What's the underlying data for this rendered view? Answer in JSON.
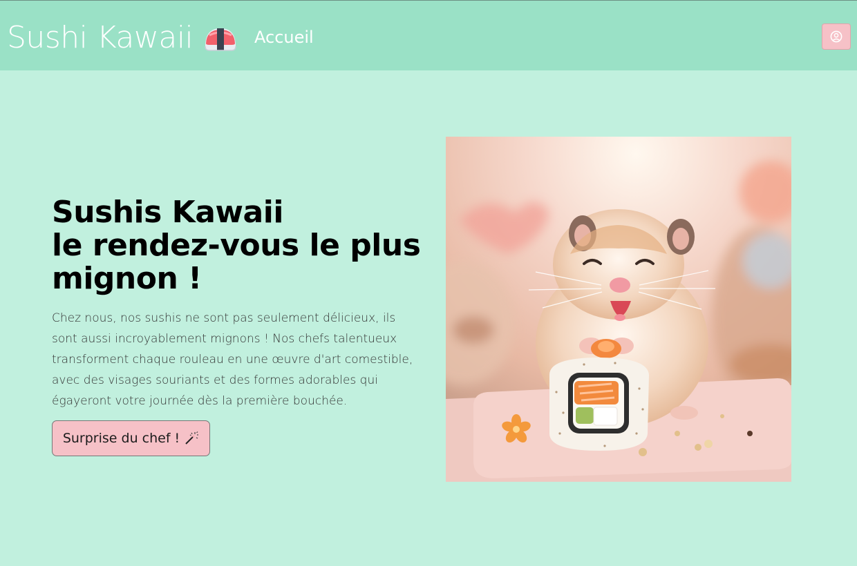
{
  "navbar": {
    "brand": "Sushi Kawaii",
    "brand_icon": "sushi-icon",
    "link_home": "Accueil",
    "user_icon": "user-circle-icon",
    "background": "#9ae1c6"
  },
  "hero": {
    "title_lines": [
      "Sushis Kawaii",
      "le rendez-vous le plus",
      "mignon !"
    ],
    "description": "Chez nous, nos sushis ne sont pas seulement délicieux, ils sont aussi incroyablement mignons ! Nos chefs talentueux transforment chaque rouleau en une œuvre d'art comestible, avec des visages souriants et des formes adorables qui égayeront votre journée dès la première bouchée.",
    "cta_label": "Surprise du chef !",
    "cta_icon": "magic-wand-icon",
    "image_icon": "hamster-sushi-image"
  },
  "colors": {
    "page_background": "#c1f0de",
    "accent_pink": "#f6c1c7"
  }
}
